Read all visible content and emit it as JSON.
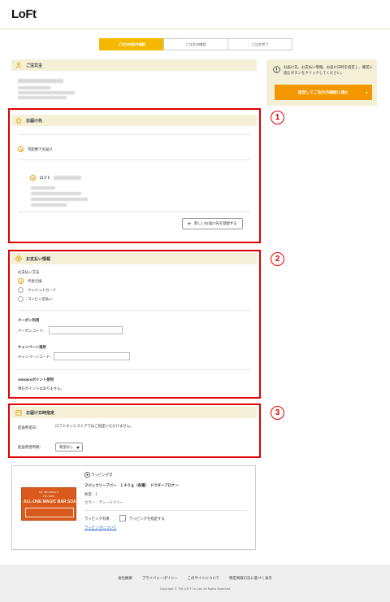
{
  "header": {
    "logo": "LoFt"
  },
  "steps": [
    "ご注文内容の確認",
    "ご注文の確認",
    "ご注文完了"
  ],
  "orderer": {
    "title": "ご注文主"
  },
  "sidebar": {
    "note": "お届け先、お支払い情報、お届け日時を指定し、確認に進むボタンをクリックしてください。",
    "confirm_button": "設定してご注文の確認に進む",
    "confirm_arrow": "›"
  },
  "delivery": {
    "title": "お届け先",
    "home_option": "宅配便でお届け",
    "address_name": "ロフト",
    "new_address_button": "新しいお届け先を登録する",
    "badge": "1"
  },
  "payment": {
    "title": "お支払い情報",
    "method_label": "お支払い方法",
    "options": [
      "代金引換",
      "クレジットカード",
      "コンビニ前払い"
    ],
    "coupon_heading": "クーポン利用",
    "coupon_label": "クーポンコード：",
    "campaign_heading": "キャンペーン適用",
    "campaign_label": "キャンペーンコード：",
    "nanaco_heading": "nanacoポイント使用",
    "nanaco_text": "現在ポイントはありません。",
    "badge": "2"
  },
  "schedule": {
    "title": "お届け日時指定",
    "date_label": "配送希望日：",
    "date_text": "ロフトネットストアではご指定いただけません。",
    "time_label": "配送希望時間：",
    "time_value": "希望なし",
    "badge": "3"
  },
  "product": {
    "wrap_badge": "ラッピング可",
    "name": "マジックソープバー　１４０ｇ（各種）　ドクターブロナー",
    "qty": "数量：1",
    "color": "カラー：ティートゥリー",
    "wrap_label": "ラッピング有無",
    "wrap_option": "ラッピングを指定する",
    "wrap_link": "ラッピングについて",
    "image_brand": "DR. BRONNER'S",
    "image_sub": "TEA TREE",
    "image_title": "ALL-ONE MAGIC BAR SOAP"
  },
  "footer": {
    "links": [
      "会社概要",
      "プライバシーポリシー",
      "このサイトについて",
      "特定商取引法に基づく表示"
    ],
    "copyright": "Copyright © THE LOFT Co.,Ltd. All Rights Reserved"
  },
  "colors": {
    "accent": "#f5b800",
    "button": "#f39800",
    "highlight": "#e00000",
    "section_bg": "#f4f0d8"
  }
}
